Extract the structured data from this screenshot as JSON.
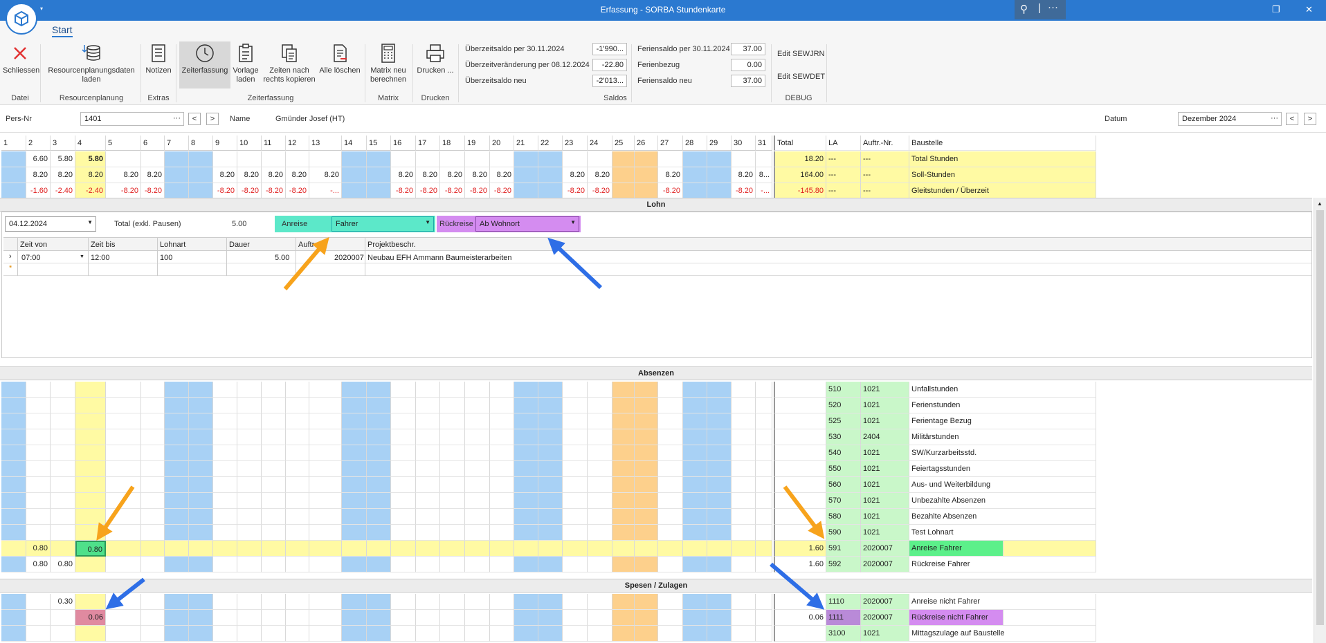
{
  "window": {
    "title": "Erfassung - SORBA Stundenkarte",
    "menu_caret": "▾"
  },
  "ribbon": {
    "tab": "Start",
    "buttons": [
      {
        "label": "Schliessen"
      },
      {
        "label": "Resourcenplanungsdaten laden"
      },
      {
        "label": "Notizen"
      },
      {
        "label": "Zeiterfassung"
      },
      {
        "label": "Vorlage laden"
      },
      {
        "label": "Zeiten nach rechts kopieren"
      },
      {
        "label": "Alle löschen"
      },
      {
        "label": "Matrix neu berechnen"
      },
      {
        "label": "Drucken ..."
      }
    ],
    "groups": [
      "Datei",
      "Resourcenplanung",
      "Extras",
      "Zeiterfassung",
      "Matrix",
      "Drucken",
      "Saldos",
      "DEBUG"
    ],
    "saldos": [
      {
        "label": "Überzeitsaldo per 30.11.2024",
        "value": "-1'990..."
      },
      {
        "label": "Überzeitveränderung per 08.12.2024",
        "value": "-22.80"
      },
      {
        "label": "Überzeitsaldo neu",
        "value": "-2'013..."
      },
      {
        "label": "Feriensaldo per 30.11.2024",
        "value": "37.00"
      },
      {
        "label": "Ferienbezug",
        "value": "0.00"
      },
      {
        "label": "Feriensaldo neu",
        "value": "37.00"
      }
    ],
    "debug": [
      "Edit SEWJRN",
      "Edit SEWDET"
    ]
  },
  "filter": {
    "pers_label": "Pers-Nr",
    "pers_value": "1401",
    "name_label": "Name",
    "name_value": "Gmünder Josef (HT)",
    "datum_label": "Datum",
    "datum_value": "Dezember 2024",
    "prev": "<",
    "next": ">",
    "dots": "···"
  },
  "grid": {
    "days": [
      "1",
      "2",
      "3",
      "4",
      "5",
      "6",
      "7",
      "8",
      "9",
      "10",
      "11",
      "12",
      "13",
      "14",
      "15",
      "16",
      "17",
      "18",
      "19",
      "20",
      "21",
      "22",
      "23",
      "24",
      "25",
      "26",
      "27",
      "28",
      "29",
      "30",
      "31"
    ],
    "headers": {
      "total": "Total",
      "la": "LA",
      "auftr": "Auftr.-Nr.",
      "baustelle": "Baustelle"
    },
    "summary_rows": [
      {
        "cells": [
          "",
          "6.60",
          "5.80",
          "5.80",
          "",
          "",
          "",
          "",
          "",
          "",
          "",
          "",
          "",
          "",
          "",
          "",
          "",
          "",
          "",
          "",
          "",
          "",
          "",
          "",
          "",
          "",
          "",
          "",
          "",
          "",
          ""
        ],
        "total": "18.20",
        "la": "---",
        "auftr": "---",
        "baustelle": "Total Stunden",
        "neg": false
      },
      {
        "cells": [
          "",
          "8.20",
          "8.20",
          "8.20",
          "8.20",
          "8.20",
          "",
          "",
          "8.20",
          "8.20",
          "8.20",
          "8.20",
          "8.20",
          "",
          "",
          "8.20",
          "8.20",
          "8.20",
          "8.20",
          "8.20",
          "",
          "",
          "8.20",
          "8.20",
          "",
          "",
          "8.20",
          "",
          "",
          "8.20",
          "8..."
        ],
        "total": "164.00",
        "la": "---",
        "auftr": "---",
        "baustelle": "Soll-Stunden",
        "neg": false
      },
      {
        "cells": [
          "",
          "-1.60",
          "-2.40",
          "-2.40",
          "-8.20",
          "-8.20",
          "",
          "",
          "-8.20",
          "-8.20",
          "-8.20",
          "-8.20",
          "-...",
          "",
          "",
          "-8.20",
          "-8.20",
          "-8.20",
          "-8.20",
          "-8.20",
          "",
          "",
          "-8.20",
          "-8.20",
          "",
          "",
          "-8.20",
          "",
          "",
          "-8.20",
          "-..."
        ],
        "total": "-145.80",
        "la": "---",
        "auftr": "---",
        "baustelle": "Gleitstunden / Überzeit",
        "neg": true
      }
    ]
  },
  "lohn": {
    "header": "Lohn",
    "date": "04.12.2024",
    "total_label": "Total (exkl. Pausen)",
    "total_value": "5.00",
    "anreise_label": "Anreise",
    "anreise_value": "Fahrer",
    "rueckreise_label": "Rückreise",
    "rueckreise_value": "Ab Wohnort",
    "columns": [
      "Zeit von",
      "Zeit bis",
      "Lohnart",
      "Dauer",
      "Auftrag",
      "Projektbeschr."
    ],
    "row": {
      "von": "07:00",
      "bis": "12:00",
      "lohnart": "100",
      "dauer": "5.00",
      "auftrag": "2020007",
      "projekt": "Neubau EFH Ammann Baumeisterarbeiten"
    },
    "new_row_marker": "*",
    "row_marker": "›"
  },
  "absenzen": {
    "header": "Absenzen",
    "rows": [
      {
        "la": "510",
        "auftr": "1021",
        "name": "Unfallstunden",
        "total": "",
        "d2": "",
        "d3": "",
        "d4": ""
      },
      {
        "la": "520",
        "auftr": "1021",
        "name": "Ferienstunden",
        "total": "",
        "d2": "",
        "d3": "",
        "d4": ""
      },
      {
        "la": "525",
        "auftr": "1021",
        "name": "Ferientage Bezug",
        "total": "",
        "d2": "",
        "d3": "",
        "d4": ""
      },
      {
        "la": "530",
        "auftr": "2404",
        "name": "Militärstunden",
        "total": "",
        "d2": "",
        "d3": "",
        "d4": ""
      },
      {
        "la": "540",
        "auftr": "1021",
        "name": "SW/Kurzarbeitsstd.",
        "total": "",
        "d2": "",
        "d3": "",
        "d4": ""
      },
      {
        "la": "550",
        "auftr": "1021",
        "name": "Feiertagsstunden",
        "total": "",
        "d2": "",
        "d3": "",
        "d4": ""
      },
      {
        "la": "560",
        "auftr": "1021",
        "name": "Aus- und Weiterbildung",
        "total": "",
        "d2": "",
        "d3": "",
        "d4": ""
      },
      {
        "la": "570",
        "auftr": "1021",
        "name": "Unbezahlte Absenzen",
        "total": "",
        "d2": "",
        "d3": "",
        "d4": ""
      },
      {
        "la": "580",
        "auftr": "1021",
        "name": "Bezahlte Absenzen",
        "total": "",
        "d2": "",
        "d3": "",
        "d4": ""
      },
      {
        "la": "590",
        "auftr": "1021",
        "name": "Test Lohnart",
        "total": "",
        "d2": "",
        "d3": "",
        "d4": ""
      },
      {
        "la": "591",
        "auftr": "2020007",
        "name": "Anreise Fahrer",
        "total": "1.60",
        "d2": "0.80",
        "d3": "",
        "d4": "0.80"
      },
      {
        "la": "592",
        "auftr": "2020007",
        "name": "Rückreise Fahrer",
        "total": "1.60",
        "d2": "0.80",
        "d3": "0.80",
        "d4": ""
      }
    ]
  },
  "spesen": {
    "header": "Spesen / Zulagen",
    "rows": [
      {
        "la": "1110",
        "auftr": "2020007",
        "name": "Anreise nicht Fahrer",
        "total": "",
        "d3": "0.30",
        "d4": ""
      },
      {
        "la": "1111",
        "auftr": "2020007",
        "name": "Rückreise nicht Fahrer",
        "total": "0.06",
        "d3": "",
        "d4": "0.06"
      },
      {
        "la": "3100",
        "auftr": "1021",
        "name": "Mittagszulage auf Baustelle",
        "total": "",
        "d3": "",
        "d4": ""
      }
    ]
  },
  "colors": {
    "titlebar": "#2b79d0",
    "blue_col": "#a8d1f5",
    "orange_col": "#fdd08c",
    "yellow": "#fffaa3",
    "green_la": "#c9f7c9",
    "arrow_orange": "#f7a31c",
    "arrow_blue": "#2e6ee6",
    "anreise": "#5ce8c9",
    "rueckreise": "#d48cf0",
    "pink": "#e08aa0"
  }
}
